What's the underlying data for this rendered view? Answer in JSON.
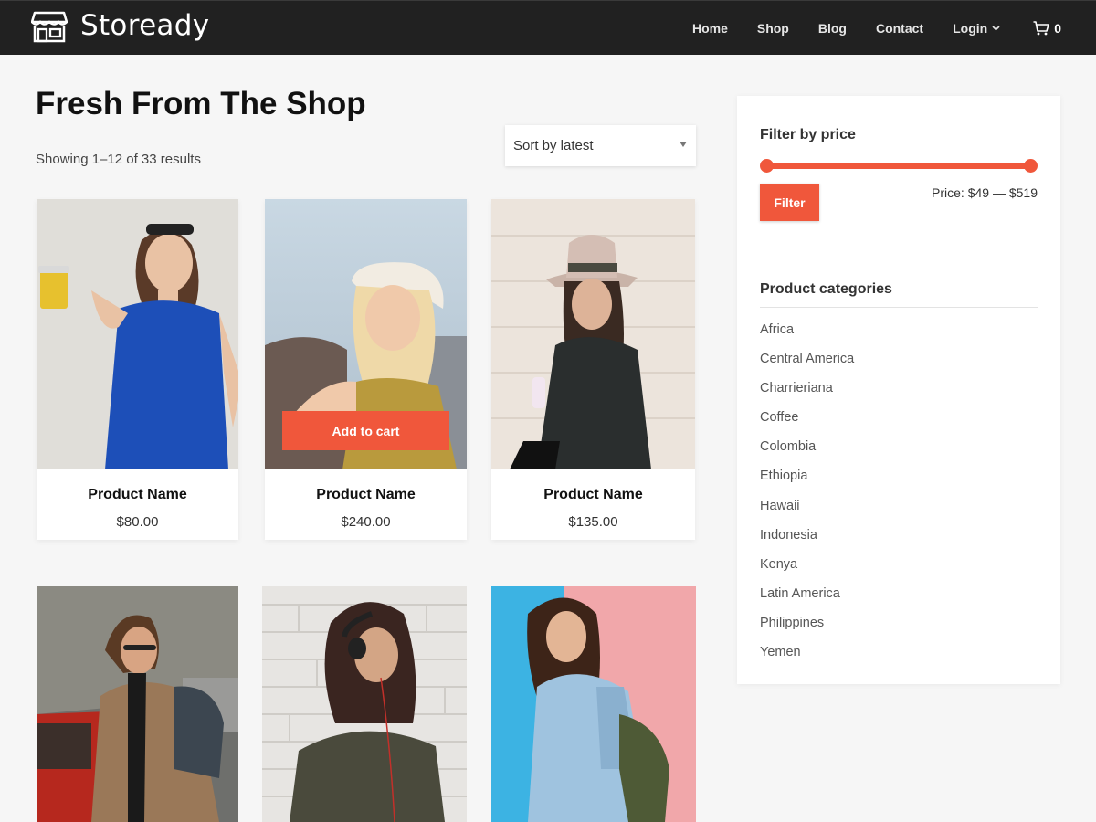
{
  "header": {
    "brand": "Stoready",
    "nav": [
      "Home",
      "Shop",
      "Blog",
      "Contact",
      "Login"
    ],
    "cart_count": "0"
  },
  "main": {
    "title": "Fresh From The Shop",
    "result_count": "Showing 1–12 of 33 results",
    "sort_selected": "Sort by latest",
    "add_to_cart_label": "Add to cart",
    "products": [
      {
        "name": "Product Name",
        "price": "$80.00"
      },
      {
        "name": "Product Name",
        "price": "$240.00"
      },
      {
        "name": "Product Name",
        "price": "$135.00"
      }
    ]
  },
  "sidebar": {
    "filter_title": "Filter by price",
    "filter_button": "Filter",
    "price_range": "Price: $49 — $519",
    "categories_title": "Product categories",
    "categories": [
      "Africa",
      "Central America",
      "Charrieriana",
      "Coffee",
      "Colombia",
      "Ethiopia",
      "Hawaii",
      "Indonesia",
      "Kenya",
      "Latin America",
      "Philippines",
      "Yemen"
    ]
  },
  "colors": {
    "accent": "#f0573b",
    "header_bg": "#212121"
  },
  "icons": [
    "storefront-icon",
    "chevron-down-icon",
    "cart-icon"
  ]
}
